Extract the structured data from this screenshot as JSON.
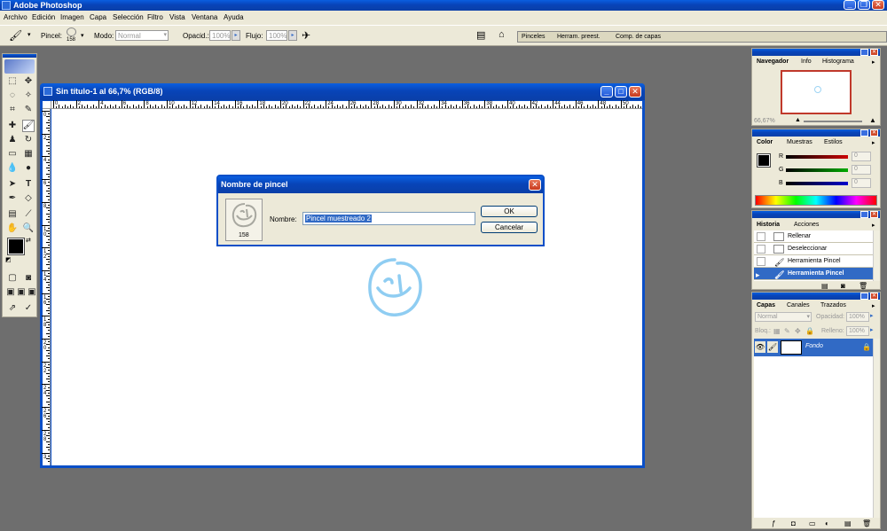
{
  "app": {
    "title": "Adobe Photoshop"
  },
  "menu": [
    "Archivo",
    "Edición",
    "Imagen",
    "Capa",
    "Selección",
    "Filtro",
    "Vista",
    "Ventana",
    "Ayuda"
  ],
  "options": {
    "brush_label": "Pincel:",
    "brush_size": "158",
    "mode_label": "Modo:",
    "mode_value": "Normal",
    "opacity_label": "Opacid.:",
    "opacity_value": "100%",
    "flow_label": "Flujo:",
    "flow_value": "100%"
  },
  "palette_well": {
    "tabs": [
      "Pinceles",
      "Herram. preest.",
      "Comp. de capas"
    ]
  },
  "document": {
    "title": "Sin título-1 al 66,7% (RGB/8)",
    "ruler_h": [
      "0",
      "2",
      "4",
      "6",
      "8",
      "10",
      "12",
      "14",
      "16",
      "18",
      "20",
      "22",
      "24",
      "26",
      "28",
      "30",
      "32",
      "34",
      "36",
      "38",
      "40",
      "42",
      "44",
      "46",
      "48",
      "50"
    ],
    "ruler_v": [
      "0",
      "2",
      "4",
      "6",
      "8",
      "1 0",
      "1 2",
      "1 4",
      "1 6",
      "1 8",
      "2 0",
      "2 2",
      "2 4",
      "2 6",
      "2 8",
      "3"
    ]
  },
  "dialog": {
    "title": "Nombre de pincel",
    "brush_size": "158",
    "name_label": "Nombre:",
    "name_value": "Pincel muestreado 2",
    "ok": "OK",
    "cancel": "Cancelar"
  },
  "navigator": {
    "tabs": [
      "Navegador",
      "Info",
      "Histograma"
    ],
    "zoom": "66,67%"
  },
  "color_panel": {
    "tabs": [
      "Color",
      "Muestras",
      "Estilos"
    ],
    "channels": [
      {
        "label": "R",
        "value": "0",
        "color": "#cc0000"
      },
      {
        "label": "G",
        "value": "0",
        "color": "#00aa00"
      },
      {
        "label": "B",
        "value": "0",
        "color": "#0000cc"
      }
    ]
  },
  "history": {
    "tabs": [
      "Historia",
      "Acciones"
    ],
    "items": [
      "Rellenar",
      "Deseleccionar",
      "Herramienta Pincel",
      "Herramienta Pincel"
    ]
  },
  "layers": {
    "tabs": [
      "Capas",
      "Canales",
      "Trazados"
    ],
    "blend": "Normal",
    "opacity_label": "Opacidad:",
    "opacity_value": "100%",
    "lock_label": "Bloq.:",
    "fill_label": "Relleno:",
    "fill_value": "100%",
    "layer_name": "Fondo"
  },
  "colors": {
    "xp_blue": "#0a4fc8",
    "selected": "#316ac5",
    "panel_bg": "#ece9d8",
    "workspace": "#6e6e6e"
  }
}
